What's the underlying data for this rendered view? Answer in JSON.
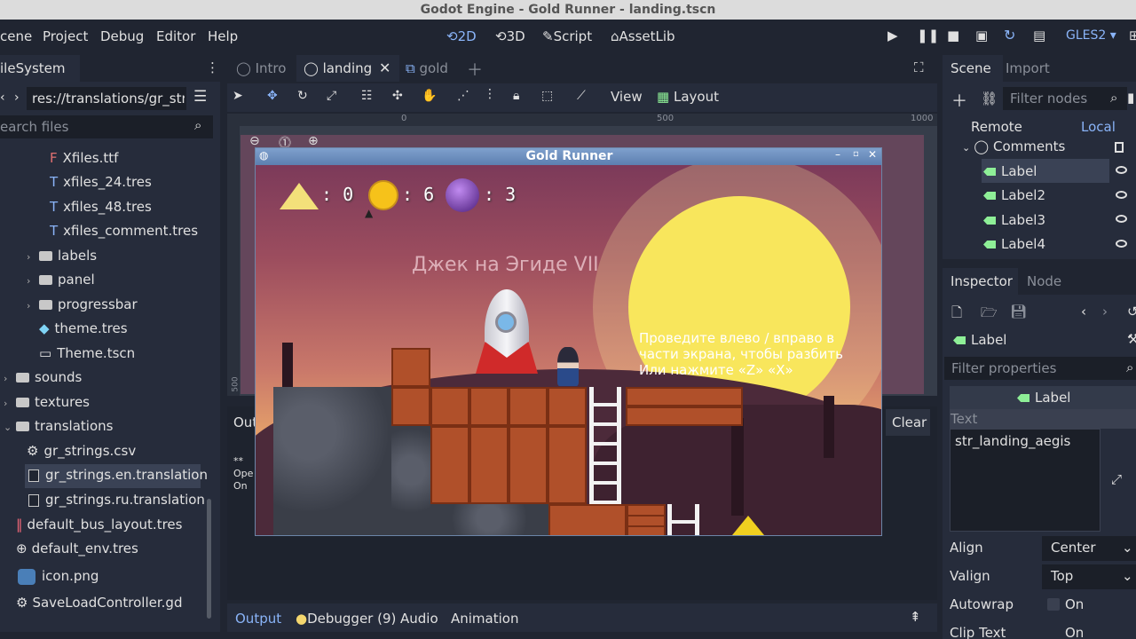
{
  "window_title": "Godot Engine - Gold Runner - landing.tscn",
  "menu": {
    "scene": "cene",
    "project": "Project",
    "debug": "Debug",
    "editor": "Editor",
    "help": "Help"
  },
  "workspaces": {
    "w2d": "2D",
    "w3d": "3D",
    "script": "Script",
    "assetlib": "AssetLib"
  },
  "renderer": "GLES2",
  "filesystem": {
    "tab": "ileSystem",
    "path": "res://translations/gr_str",
    "search_placeholder": "earch files",
    "items": [
      {
        "label": "Xfiles.ttf",
        "icon": "font-icon"
      },
      {
        "label": "xfiles_24.tres",
        "icon": "font-resource-icon"
      },
      {
        "label": "xfiles_48.tres",
        "icon": "font-resource-icon"
      },
      {
        "label": "xfiles_comment.tres",
        "icon": "font-resource-icon"
      },
      {
        "label": "labels",
        "icon": "folder-icon"
      },
      {
        "label": "panel",
        "icon": "folder-icon"
      },
      {
        "label": "progressbar",
        "icon": "folder-icon"
      },
      {
        "label": "theme.tres",
        "icon": "theme-icon"
      },
      {
        "label": "Theme.tscn",
        "icon": "scene-icon"
      },
      {
        "label": "sounds",
        "icon": "folder-icon"
      },
      {
        "label": "textures",
        "icon": "folder-icon"
      },
      {
        "label": "translations",
        "icon": "folder-icon"
      },
      {
        "label": "gr_strings.csv",
        "icon": "csv-icon"
      },
      {
        "label": "gr_strings.en.translation",
        "icon": "file-icon"
      },
      {
        "label": "gr_strings.ru.translation",
        "icon": "file-icon"
      },
      {
        "label": "default_bus_layout.tres",
        "icon": "bus-layout-icon"
      },
      {
        "label": "default_env.tres",
        "icon": "environment-icon"
      },
      {
        "label": "icon.png",
        "icon": "image-icon"
      },
      {
        "label": "SaveLoadController.gd",
        "icon": "gear-icon"
      }
    ]
  },
  "editor_tabs": [
    {
      "label": "Intro",
      "active": false
    },
    {
      "label": "landing",
      "active": true
    },
    {
      "label": "gold",
      "active": false
    }
  ],
  "toolbar": {
    "view": "View",
    "layout": "Layout"
  },
  "ruler": {
    "t0": "0",
    "t500": "500",
    "t1000": "1000",
    "v500": "500"
  },
  "output_panel": {
    "label": "Out",
    "clear": "Clear",
    "lines": [
      "**",
      "Ope",
      "On"
    ]
  },
  "bottom_tabs": {
    "output": "Output",
    "debugger": "Debugger (9)",
    "audio": "Audio",
    "animation": "Animation"
  },
  "game": {
    "title": "Gold Runner",
    "hud": {
      "gold": ": 0",
      "coins": ": 6",
      "orbs": ": 3"
    },
    "level_title": "Джек на Эгиде VII",
    "hint": [
      "Проведите влево / вправо в",
      "части экрана, чтобы разбить",
      "Или нажмите «Z» «X»"
    ]
  },
  "scene_panel": {
    "tab_scene": "Scene",
    "tab_import": "Import",
    "filter_placeholder": "Filter nodes",
    "remote": "Remote",
    "local": "Local",
    "nodes": [
      "Comments",
      "Label",
      "Label2",
      "Label3",
      "Label4"
    ]
  },
  "inspector": {
    "tab_inspector": "Inspector",
    "tab_node": "Node",
    "object": "Label",
    "filter_placeholder": "Filter properties",
    "section": "Label",
    "text_label": "Text",
    "text_value": "str_landing_aegis",
    "align_label": "Align",
    "align_value": "Center",
    "valign_label": "Valign",
    "valign_value": "Top",
    "autowrap_label": "Autowrap",
    "autowrap_value": "On",
    "cliptext_label": "Clip Text",
    "cliptext_value": "On"
  },
  "colors": {
    "accent": "#8ab4f8",
    "node_green": "#8eef97",
    "bg": "#202531",
    "panel": "#262c3b"
  }
}
